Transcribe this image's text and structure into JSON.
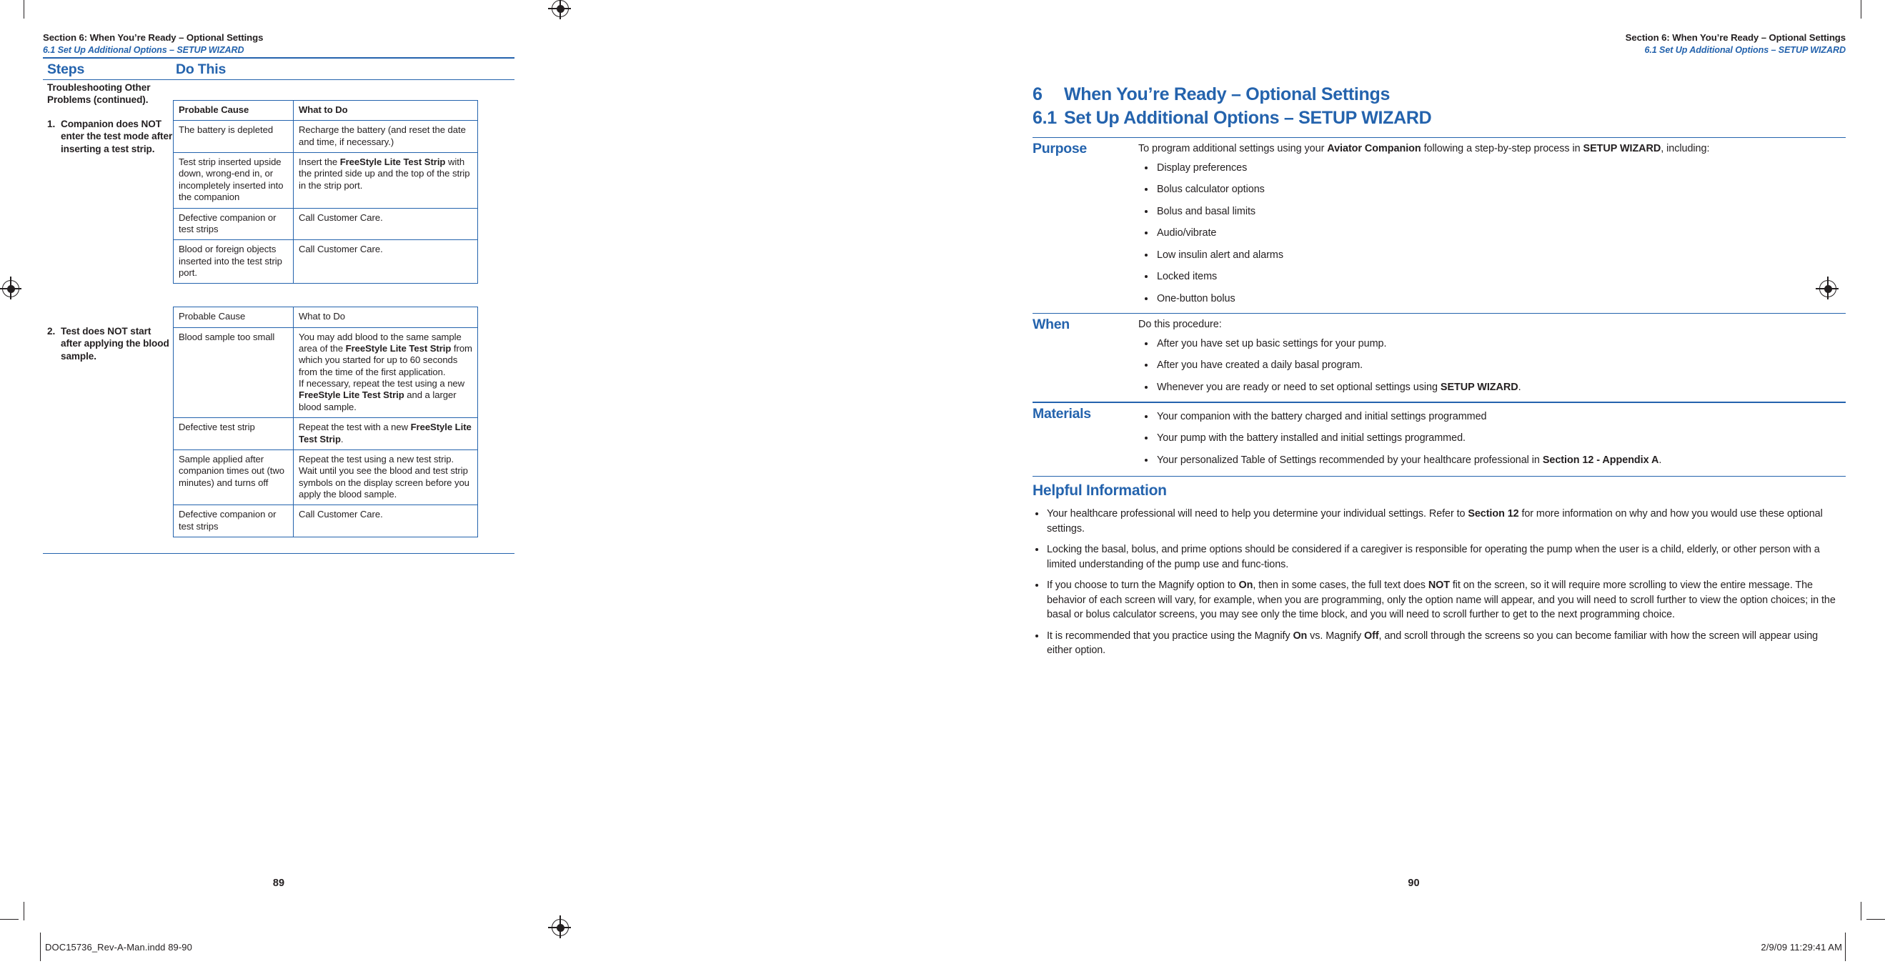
{
  "left_page": {
    "running_head": {
      "line1": "Section 6: When You’re Ready – Optional Settings",
      "line2": "6.1 Set Up Additional Options – SETUP WIZARD"
    },
    "column_headers": {
      "steps": "Steps",
      "do_this": "Do This"
    },
    "lead_in": "Troubleshooting Other Problems (continued).",
    "steps": [
      {
        "number": "1.",
        "text": "Companion does NOT enter the test mode after inserting a test strip.",
        "table": {
          "headers": [
            "Probable Cause",
            "What to Do"
          ],
          "header_bold": true,
          "rows": [
            {
              "cause": "The battery is depleted",
              "todo_html": "Recharge the battery (and reset the date and time, if necessary.)"
            },
            {
              "cause": "Test strip inserted upside down, wrong-end in, or incompletely inserted into the companion",
              "todo_html": "Insert the <b>FreeStyle Lite Test Strip</b> with the printed side up and the top of the strip in the strip port."
            },
            {
              "cause": "Defective companion or test strips",
              "todo_html": "Call Customer Care."
            },
            {
              "cause": "Blood or foreign objects inserted into the test strip port.",
              "todo_html": "Call Customer Care."
            }
          ]
        }
      },
      {
        "number": "2.",
        "text": "Test does NOT start after applying the blood sample.",
        "table": {
          "headers": [
            "Probable Cause",
            "What to Do"
          ],
          "header_bold": false,
          "rows": [
            {
              "cause": "Blood sample too small",
              "todo_html": "You may add blood to the same sample area of the <b>FreeStyle Lite Test Strip</b> from which you started for up to 60 seconds from the time of the first application.<br>If necessary, repeat the test using a new <b>FreeStyle Lite Test Strip</b> and a larger blood sample."
            },
            {
              "cause": "Defective test strip",
              "todo_html": "Repeat the test with a new <b>FreeStyle Lite Test Strip</b>."
            },
            {
              "cause": "Sample applied after companion times out (two minutes) and turns off",
              "todo_html": "Repeat the test using a new test strip.<br>Wait until you see the blood and test strip symbols on the display screen before you apply the blood sample."
            },
            {
              "cause": "Defective companion or test strips",
              "todo_html": "Call Customer Care."
            }
          ]
        }
      }
    ],
    "page_number": "89"
  },
  "right_page": {
    "running_head": {
      "line1": "Section 6: When You’re Ready – Optional Settings",
      "line2": "6.1 Set Up Additional Options – SETUP WIZARD"
    },
    "title_section": {
      "number": "6",
      "text": "When You’re Ready – Optional Settings"
    },
    "title_subsection": {
      "number": "6.1",
      "text": "Set Up Additional Options – SETUP WIZARD"
    },
    "purpose": {
      "label": "Purpose",
      "intro_html": "To program additional settings using your <b>Aviator Companion</b> following a step-by-step process in <b>SETUP WIZARD</b>, including:",
      "items": [
        "Display preferences",
        "Bolus calculator options",
        "Bolus and basal limits",
        "Audio/vibrate",
        "Low insulin alert and alarms",
        "Locked items",
        "One-button bolus"
      ]
    },
    "when": {
      "label": "When",
      "intro_html": "Do this procedure:",
      "items_html": [
        "After you have set up basic settings for your pump.",
        "After you have created a daily basal program.",
        "Whenever you are ready or need to set optional settings using <b>SETUP WIZARD</b>."
      ]
    },
    "materials": {
      "label": "Materials",
      "items_html": [
        "Your companion with the battery charged and initial settings programmed",
        "Your pump with the battery installed and initial settings programmed.",
        "Your personalized Table of Settings recommended by your healthcare professional in <b>Section 12 - Appendix A</b>."
      ]
    },
    "helpful_information": {
      "heading": "Helpful Information",
      "items_html": [
        "Your healthcare professional will need to help you determine your individual settings. Refer to <b>Section 12</b> for more information on why and how you would use these optional settings.",
        "Locking the basal, bolus, and prime options should be considered if a caregiver is responsible for operating the pump when the user is a child, elderly, or other person with a limited understanding of the pump use and func-tions.",
        "If you choose to turn the Magnify option to <b>On</b>, then in some cases, the full text does <b>NOT</b> fit on the screen, so it will require more scrolling to view the entire message. The behavior of each screen will vary, for example, when you are programming, only the option name will appear, and you will need to scroll further to view the option choices; in the basal or bolus calculator screens, you may see only the time block, and you will need to scroll further to get to the next programming choice.",
        "It is recommended that you practice using the Magnify <b>On</b> vs. Magnify <b>Off</b>, and scroll through the screens so you can become familiar with how the screen will appear using either option."
      ]
    },
    "page_number": "90"
  },
  "imposition": {
    "file_label": "DOC15736_Rev-A-Man.indd   89-90",
    "timestamp": "2/9/09   11:29:41 AM"
  },
  "colors": {
    "accent_blue": "#2463ad",
    "body_black": "#231f20"
  }
}
